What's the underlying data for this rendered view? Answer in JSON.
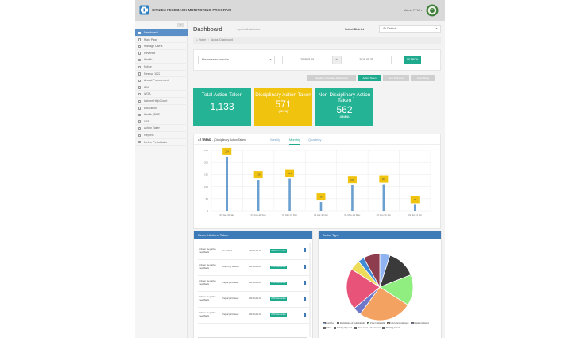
{
  "header": {
    "app_title": "CITIZEN FEEDBACK MONITORING PROGRAM",
    "admin_label": "Admin PFM ▼"
  },
  "sidebar": {
    "items": [
      {
        "label": "Dashboard",
        "active": true,
        "chevron": false
      },
      {
        "label": "Main Page",
        "active": false,
        "chevron": false
      },
      {
        "label": "Manage Users",
        "active": false,
        "chevron": false
      },
      {
        "label": "Revenue",
        "active": false,
        "chevron": true
      },
      {
        "label": "Health",
        "active": false,
        "chevron": true
      },
      {
        "label": "Police",
        "active": false,
        "chevron": true
      },
      {
        "label": "Rescue 1122",
        "active": false,
        "chevron": false
      },
      {
        "label": "Ahead Procurement",
        "active": false,
        "chevron": true
      },
      {
        "label": "LDA",
        "active": false,
        "chevron": false
      },
      {
        "label": "WOA",
        "active": false,
        "chevron": true
      },
      {
        "label": "Lahore High Court",
        "active": false,
        "chevron": true
      },
      {
        "label": "Education",
        "active": false,
        "chevron": false
      },
      {
        "label": "Health (PHF)",
        "active": false,
        "chevron": true
      },
      {
        "label": "SSP",
        "active": false,
        "chevron": false
      },
      {
        "label": "Action Taken",
        "active": false,
        "chevron": false
      },
      {
        "label": "Reports",
        "active": false,
        "chevron": true
      },
      {
        "label": "Define Periodicals",
        "active": false,
        "chevron": true
      }
    ]
  },
  "page": {
    "title": "Dashboard",
    "subtitle": "reports & statistics",
    "district_label": "Select District",
    "district_value": "All District",
    "breadcrumb": [
      "Home",
      "Action Dashboard"
    ]
  },
  "filters": {
    "service_placeholder": "Please select service",
    "date_from": "2019-01-01",
    "date_sep": "to",
    "date_to": "2019-01-31",
    "search_label": "SEARCH"
  },
  "view_tabs": [
    {
      "label": "Negative Feedback Dashboard",
      "active": false
    },
    {
      "label": "Action Taken",
      "active": true
    },
    {
      "label": "Best Practices",
      "active": false
    },
    {
      "label": "Case Study",
      "active": false
    }
  ],
  "stats": {
    "total": {
      "title": "Total Action Taken",
      "value": "1,133",
      "color": "#24b394"
    },
    "disciplinary": {
      "title": "Disciplinary Action Taken",
      "value": "571",
      "pct": "(50.4%)",
      "color": "#f0c30f"
    },
    "non_disciplinary": {
      "title": "Non-Disciplinary Action Taken",
      "value": "562",
      "pct": "(49.6%)",
      "color": "#24b394"
    }
  },
  "trend": {
    "title_prefix": "TREND",
    "title_rest": " - (Disciplinary Action Taken)",
    "tabs": [
      {
        "label": "Weekly",
        "active": false
      },
      {
        "label": "Monthly",
        "active": true
      },
      {
        "label": "Quarterly",
        "active": false
      }
    ]
  },
  "chart_data": {
    "type": "bar",
    "categories": [
      "01 Jan-31 Jan",
      "01 Feb-28 Feb",
      "01 Mar-31 Mar",
      "01 Apr-30 Apr",
      "01 May-31 May",
      "01 Jun-30 Jun",
      "01 Jul-31 Jul"
    ],
    "series": [
      {
        "values": [
          224,
          128,
          133,
          36,
          108,
          110,
          25
        ]
      }
    ],
    "ytick_labels": [
      "0",
      "50",
      "100",
      "150",
      "200",
      "250"
    ],
    "ylim": [
      0,
      250
    ],
    "grid": true,
    "bar_color": "#6a9fd0",
    "label_color": "#f0c30f"
  },
  "recent": {
    "title": "Recent Actions Taken",
    "rows": [
      {
        "name": "Citizen Negative Feedback",
        "action": "Counfled",
        "date": "2019-05-01",
        "status": "PFM Intervention"
      },
      {
        "name": "Citizen Negative Feedback",
        "action": "Warning issued",
        "date": "2019-05-01",
        "status": "PFM Intervention"
      },
      {
        "name": "Citizen Negative Feedback",
        "action": "Inquiry Initiated",
        "date": "2019-05-01",
        "status": "PFM Intervention"
      },
      {
        "name": "Citizen Negative Feedback",
        "action": "Inquiry Initiated",
        "date": "2019-05-01",
        "status": "PFM Intervention"
      },
      {
        "name": "Citizen Negative Feedback",
        "action": "Inquiry Initiated",
        "date": "2019-05-01",
        "status": "PFM Intervention"
      }
    ]
  },
  "action_type": {
    "title": "Action Type",
    "slices": [
      {
        "label": "Counfled",
        "value": 5,
        "color": "#8fb2f0"
      },
      {
        "label": "Resignation of complainant",
        "value": 14,
        "color": "#3a3a3a"
      },
      {
        "label": "Fake Complaint",
        "value": 15,
        "color": "#90ee80"
      },
      {
        "label": "Grievance redressed",
        "value": 26,
        "color": "#f4a261"
      },
      {
        "label": "Inquiry initiated",
        "value": 4,
        "color": "#6f78c8"
      },
      {
        "label": "Other",
        "value": 20,
        "color": "#e8537a"
      },
      {
        "label": "Penalty imposed",
        "value": 5,
        "color": "#ecdc5a"
      },
      {
        "label": "Show cause notice issued",
        "value": 3,
        "color": "#3f8bd8"
      },
      {
        "label": "Warning issued",
        "value": 8,
        "color": "#8d3d4e"
      }
    ]
  }
}
